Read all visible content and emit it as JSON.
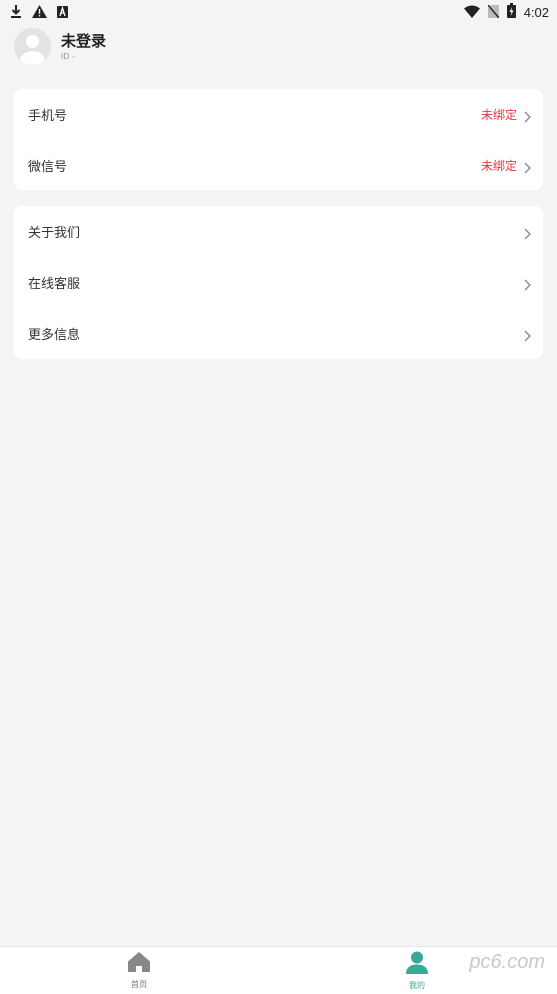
{
  "status_bar": {
    "time": "4:02",
    "icons": [
      "download-icon",
      "warning-icon",
      "a-box-icon",
      "wifi-icon",
      "no-sim-icon",
      "battery-icon"
    ]
  },
  "profile": {
    "name": "未登录",
    "id_text": "ID -"
  },
  "account_section": {
    "items": [
      {
        "label": "手机号",
        "value": "未绑定"
      },
      {
        "label": "微信号",
        "value": "未绑定"
      }
    ]
  },
  "info_section": {
    "items": [
      {
        "label": "关于我们"
      },
      {
        "label": "在线客服"
      },
      {
        "label": "更多信息"
      }
    ]
  },
  "tabbar": {
    "tabs": [
      {
        "label": "首页",
        "icon": "home-icon"
      },
      {
        "label": "我的",
        "icon": "person-icon"
      }
    ],
    "active_color": "#3aa99a",
    "inactive_color": "#777777"
  },
  "colors": {
    "background": "#f4f4f4",
    "unbound": "#e0393e"
  },
  "watermark": "pc6.com"
}
